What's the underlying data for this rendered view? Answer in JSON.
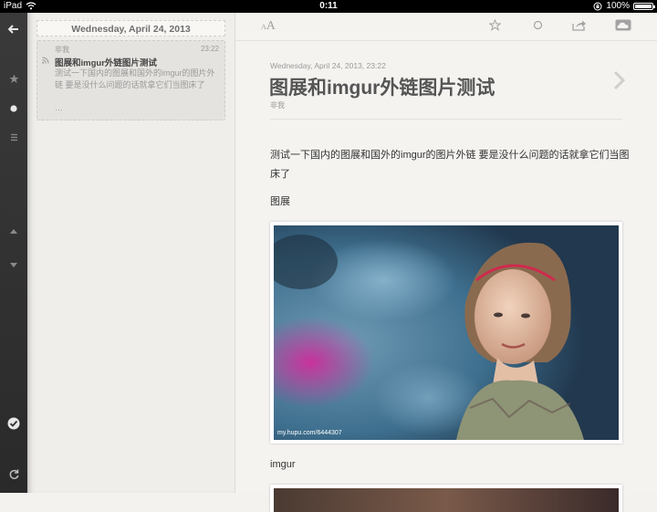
{
  "status": {
    "device": "iPad",
    "time": "0:11",
    "battery": "100%",
    "battery_level": 1.0
  },
  "sidebar": {
    "icons": [
      "back-arrow-icon",
      "star-icon",
      "dot-icon",
      "list-icon",
      "up-arrow-icon",
      "down-arrow-icon",
      "check-icon",
      "refresh-icon"
    ]
  },
  "list": {
    "date_header": "Wednesday, April 24, 2013",
    "items": [
      {
        "feed": "非我",
        "time": "23:22",
        "title": "图展和imgur外链图片测试",
        "excerpt": "测试一下国内的图展和国外的imgur的图片外链 要是没什么问题的话就拿它们当图床了",
        "more": "…"
      }
    ]
  },
  "toolbar": {
    "font_small": "A",
    "font_large": "A",
    "icons": [
      "font-size-icon",
      "star-icon",
      "circle-icon",
      "share-icon",
      "cloud-icon"
    ]
  },
  "article": {
    "date": "Wednesday, April 24, 2013, 23:22",
    "title": "图展和imgur外链图片测试",
    "author": "非我",
    "body": "测试一下国内的图展和国外的imgur的图片外链 要是没什么问题的话就拿它们当图床了",
    "label1": "图展",
    "photo_caption": "my.hupu.com/6444307",
    "label2": "imgur"
  },
  "colors": {
    "accent": "#555555",
    "sidebar": "#2f2f2f",
    "background": "#f4f3f0"
  }
}
